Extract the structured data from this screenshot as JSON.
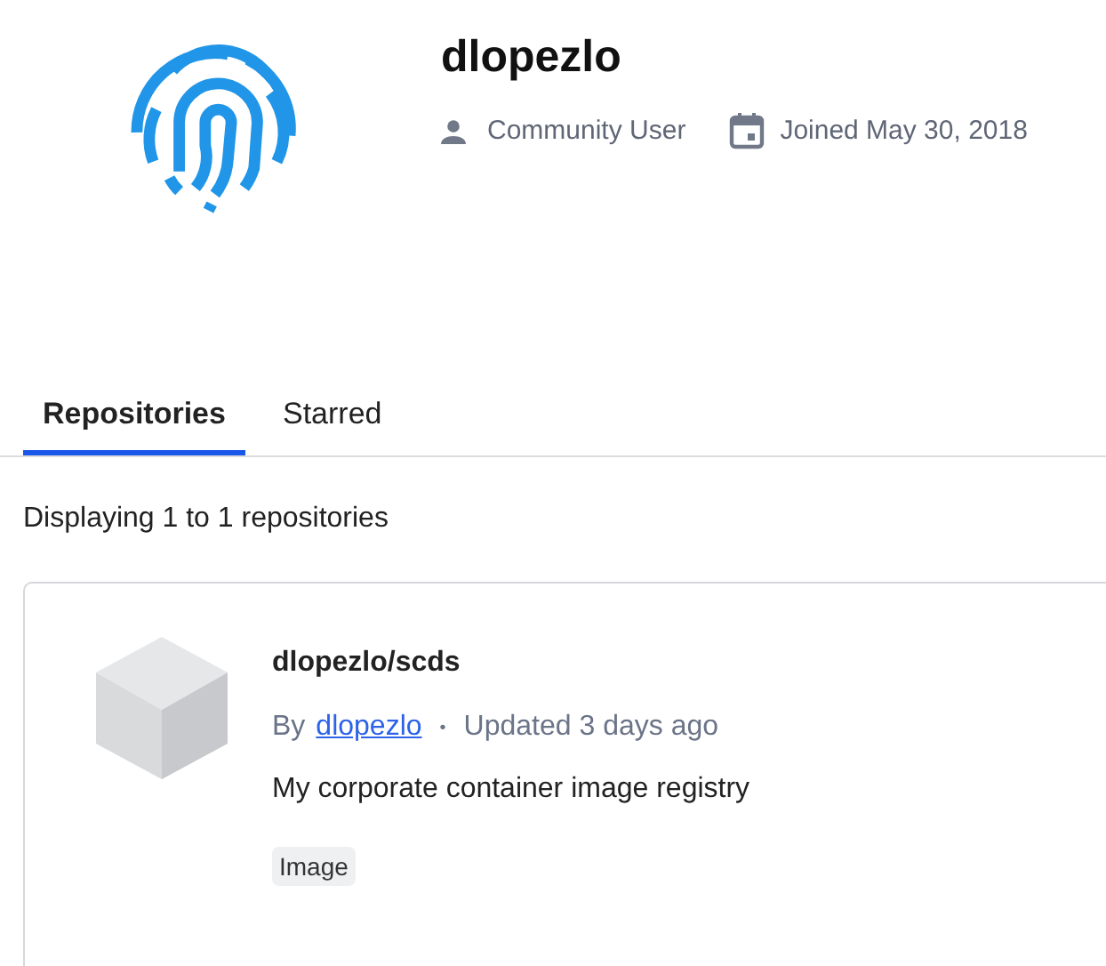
{
  "profile": {
    "name": "dlopezlo",
    "role": "Community User",
    "joined": "Joined May 30, 2018"
  },
  "tabs": [
    {
      "label": "Repositories",
      "selected": true
    },
    {
      "label": "Starred",
      "selected": false
    }
  ],
  "summary": "Displaying 1 to 1 repositories",
  "repositories": [
    {
      "name": "dlopezlo/scds",
      "by": "By",
      "owner": "dlopezlo",
      "separator": "•",
      "updated": "Updated 3 days ago",
      "description": "My corporate container image registry",
      "tags": [
        "Image"
      ]
    }
  ]
}
